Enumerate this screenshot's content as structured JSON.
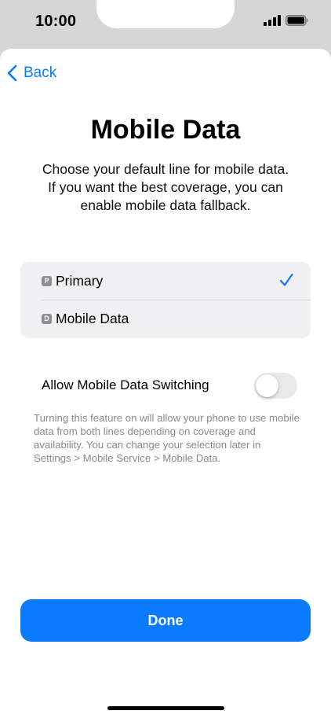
{
  "status_bar": {
    "time": "10:00",
    "signal_icon": "cellular-signal-icon",
    "battery_icon": "battery-full-icon"
  },
  "nav": {
    "back_label": "Back",
    "back_icon": "chevron-left-icon"
  },
  "header": {
    "title": "Mobile Data",
    "subtitle": "Choose your default line for mobile data. If you want the best coverage, you can enable mobile data fallback."
  },
  "lines": [
    {
      "badge": "P",
      "label": "Primary",
      "selected": true
    },
    {
      "badge": "D",
      "label": "Mobile Data",
      "selected": false
    }
  ],
  "switching": {
    "label": "Allow Mobile Data Switching",
    "enabled": false,
    "footnote": "Turning this feature on will allow your phone to use mobile data from both lines depending on coverage and availability. You can change your selection later in Settings > Mobile Service > Mobile Data."
  },
  "actions": {
    "done_label": "Done"
  },
  "colors": {
    "accent": "#0a7aff",
    "toggle_off": "#e9e9ea",
    "group_background": "#f0f0f2",
    "footnote_text": "#8a8a8e",
    "status_background": "#d6d6d6"
  }
}
